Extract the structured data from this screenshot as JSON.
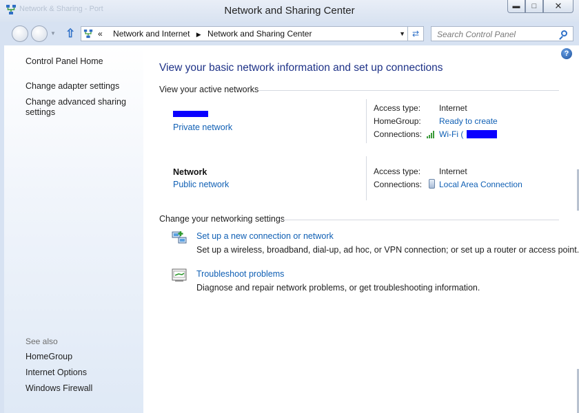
{
  "window": {
    "title": "Network and Sharing Center",
    "ghost_title": "Network & Sharing - Port"
  },
  "nav": {
    "breadcrumb_prefix": "«",
    "breadcrumb": [
      "Network and Internet",
      "Network and Sharing Center"
    ],
    "search_placeholder": "Search Control Panel"
  },
  "sidebar": {
    "home": "Control Panel Home",
    "items": [
      "Change adapter settings",
      "Change advanced sharing settings"
    ],
    "see_also_label": "See also",
    "see_also": [
      "HomeGroup",
      "Internet Options",
      "Windows Firewall"
    ]
  },
  "main": {
    "title": "View your basic network information and set up connections",
    "active_networks_header": "View your active networks",
    "networks": [
      {
        "name": "",
        "category": "Private network",
        "access_type_label": "Access type:",
        "access_type": "Internet",
        "homegroup_label": "HomeGroup:",
        "homegroup": "Ready to create",
        "connections_label": "Connections:",
        "connection": "Wi-Fi ("
      },
      {
        "name": "Network",
        "category": "Public network",
        "access_type_label": "Access type:",
        "access_type": "Internet",
        "connections_label": "Connections:",
        "connection": "Local Area Connection"
      }
    ],
    "settings_header": "Change your networking settings",
    "tasks": [
      {
        "title": "Set up a new connection or network",
        "desc": "Set up a wireless, broadband, dial-up, ad hoc, or VPN connection; or set up a router or access point.",
        "icon": "network-setup-icon"
      },
      {
        "title": "Troubleshoot problems",
        "desc": "Diagnose and repair network problems, or get troubleshooting information.",
        "icon": "troubleshoot-icon"
      }
    ]
  },
  "colors": {
    "link": "#0f5fb4",
    "title": "#1e3287",
    "redaction": "#0a00ff"
  }
}
